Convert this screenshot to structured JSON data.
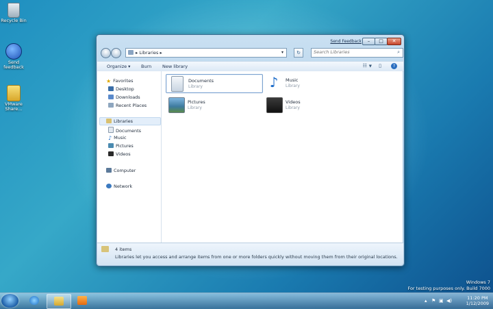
{
  "desktop": {
    "icons": [
      {
        "label": "Recycle Bin",
        "icon": "recycle-bin-icon"
      },
      {
        "label": "Send feedback",
        "icon": "send-feedback-icon"
      },
      {
        "label": "VMware Share...",
        "icon": "vmware-shared-folder-icon"
      }
    ],
    "watermark": {
      "line1": "Windows 7",
      "line2": "For testing purposes only. Build 7000"
    }
  },
  "window": {
    "send_feedback": "Send Feedback",
    "controls": {
      "minimize": "–",
      "maximize": "□",
      "close": "✕"
    },
    "address": {
      "breadcrumb": "Libraries",
      "separator": "▸"
    },
    "search": {
      "placeholder": "Search Libraries"
    },
    "commands": {
      "organize": "Organize ▾",
      "burn": "Burn",
      "new_library": "New library"
    },
    "nav": {
      "favorites": "Favorites",
      "favorites_items": [
        "Desktop",
        "Downloads",
        "Recent Places"
      ],
      "libraries": "Libraries",
      "libraries_items": [
        "Documents",
        "Music",
        "Pictures",
        "Videos"
      ],
      "computer": "Computer",
      "network": "Network"
    },
    "libraries": [
      {
        "name": "Documents",
        "type": "Library",
        "icon": "documents-library-icon"
      },
      {
        "name": "Music",
        "type": "Library",
        "icon": "music-library-icon"
      },
      {
        "name": "Pictures",
        "type": "Library",
        "icon": "pictures-library-icon"
      },
      {
        "name": "Videos",
        "type": "Library",
        "icon": "videos-library-icon"
      }
    ],
    "status": {
      "count": "4 items",
      "description": "Libraries let you access and arrange items from one or more folders quickly without moving them from their original locations."
    }
  },
  "taskbar": {
    "pinned": [
      "internet-explorer-icon",
      "windows-explorer-icon",
      "media-player-icon"
    ],
    "clock": {
      "time": "11:20 PM",
      "date": "1/12/2009"
    }
  },
  "colors": {
    "accent": "#1f53b8",
    "window_frame": "#a9c9e4",
    "close": "#c7452b"
  }
}
